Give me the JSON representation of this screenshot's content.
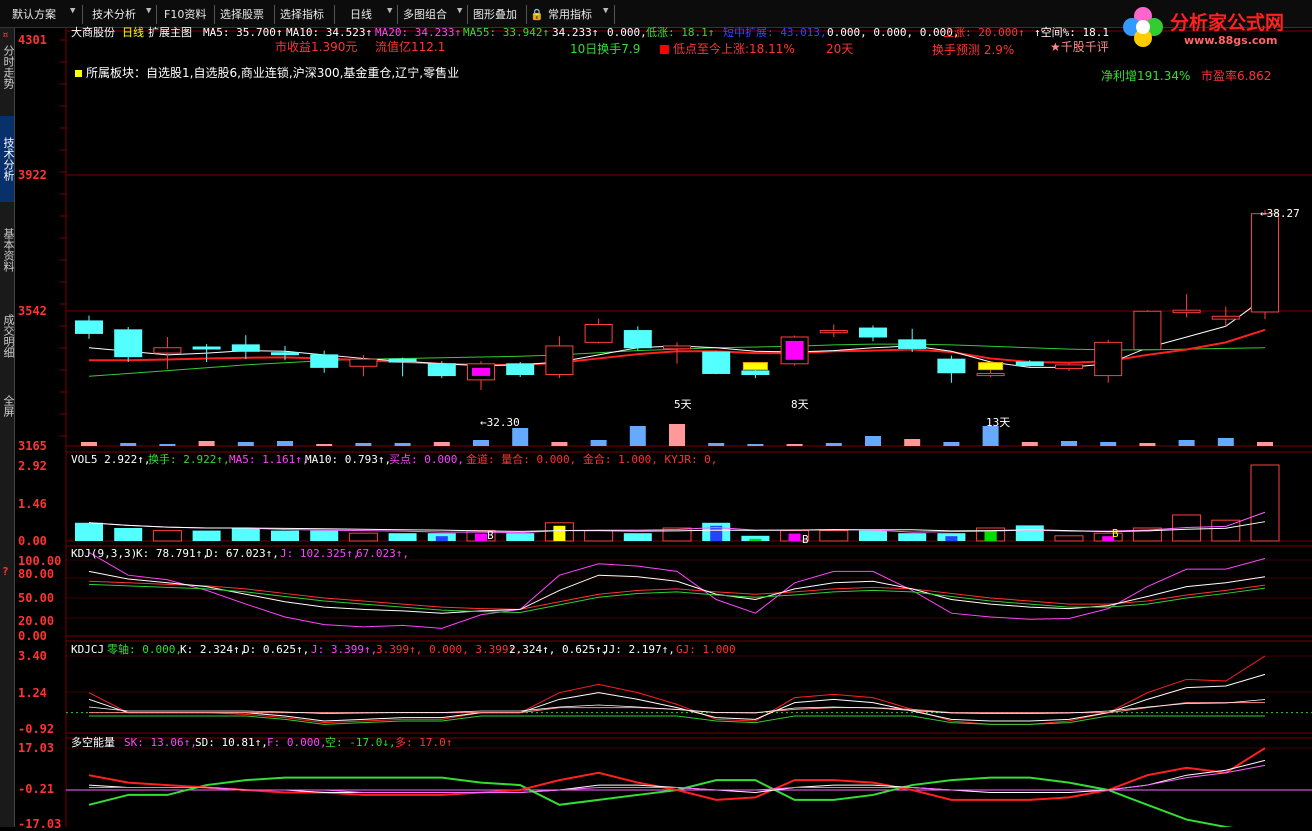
{
  "toolbar": {
    "items": [
      {
        "label": "默认方案",
        "arrow": true
      },
      {
        "label": "技术分析",
        "arrow": true
      },
      {
        "label": "F10资料",
        "arrow": false
      },
      {
        "label": "选择股票",
        "arrow": false
      },
      {
        "label": "选择指标",
        "arrow": false
      },
      {
        "label": "日线",
        "arrow": true
      },
      {
        "label": "多图组合",
        "arrow": true
      },
      {
        "label": "图形叠加",
        "arrow": false
      },
      {
        "label": "常用指标",
        "arrow": true
      }
    ]
  },
  "left_tabs": [
    "分时走势",
    "技术分析",
    "基本资料",
    "成交明细",
    "全屏"
  ],
  "logo": {
    "title": "分析家公式网",
    "url": "www.88gs.com"
  },
  "main_chart": {
    "stock_name": "大商股份",
    "period": "日线",
    "main_label": "扩展主图",
    "ma5": "MA5: 35.700↑",
    "ma10": "MA10: 34.523↑",
    "ma20": "MA20: 34.233↑",
    "ma55": "MA55: 33.942↑",
    "v1": "34.233↑",
    "v2": "0.000,",
    "low_rise": "低涨: 18.1↑",
    "hidden": "短中扩展: 43.013,",
    "v3": "0.000, 0.000, 0.000,",
    "rise": "上涨: 20.000↑",
    "space": "↑空间%: 18.1",
    "eps": "市收益1.390元",
    "float_cap": "流值亿112.1",
    "turnover10": "10日换手7.9",
    "low_to_now": "低点至今上涨:18.11%",
    "days": "20天",
    "turnover_forecast": "换手预测 2.9%",
    "rating": "★千股千评",
    "net_profit": "净利增191.34%",
    "pe": "市盈率6.862",
    "sector": "所属板块：自选股1,自选股6,商业连锁,沪深300,基金重仓,辽宁,零售业",
    "y_labels": [
      "4301",
      "3922",
      "3542",
      "3165"
    ],
    "annot_low": "←32.30",
    "annot_high": "←38.27",
    "annot_5d": "5天",
    "annot_8d": "8天",
    "annot_13d": "13天"
  },
  "vol_panel": {
    "header": [
      "VOL5 2.922↑,",
      "换手: 2.922↑,",
      "MA5: 1.161↑,",
      "MA10: 0.793↑,",
      "买点: 0.000,",
      "金道: 量合: 0.000, 金合: 1.000, KYJR: 0,"
    ],
    "y_labels": [
      "2.92",
      "1.46",
      "0.00"
    ],
    "b1": "B",
    "b2": "B",
    "b3": "B"
  },
  "kdj_panel": {
    "header": [
      "KDJ(9,3,3)",
      "K: 78.791↑,",
      "D: 67.023↑,",
      "J: 102.325↑,",
      "67.023↑,"
    ],
    "y_labels": [
      "100.00",
      "80.00",
      "50.00",
      "20.00",
      "0.00"
    ]
  },
  "kdjcj_panel": {
    "header": [
      "KDJCJ",
      "零轴: 0.000,",
      "K: 2.324↑,",
      "D: 0.625↑,",
      "J: 3.399↑,",
      "3.399↑, 0.000, 3.399↑,",
      "2.324↑, 0.625↑,",
      "JJ: 2.197↑,",
      "GJ: 1.000"
    ],
    "y_labels": [
      "3.40",
      "1.24",
      "-0.92"
    ]
  },
  "duokong_panel": {
    "header": [
      "多空能量",
      "SK: 13.06↑,",
      "SD: 10.81↑,",
      "F: 0.000,",
      "空: -17.0↓,",
      "多: 17.0↑"
    ],
    "y_labels": [
      "17.03",
      "-0.21",
      "-17.03"
    ]
  },
  "colors": {
    "grid": "#7a0000",
    "up": "#ff4040",
    "down": "#54ffff",
    "ma_white": "#ffffff",
    "ma_green": "#33cc33",
    "ma_red": "#ff2020",
    "magenta": "#ff00ff"
  },
  "candles": [
    {
      "o": 3515,
      "c": 3480,
      "h": 3530,
      "l": 3465,
      "dir": "down"
    },
    {
      "o": 3490,
      "c": 3415,
      "h": 3498,
      "l": 3400,
      "dir": "down"
    },
    {
      "o": 3425,
      "c": 3440,
      "h": 3470,
      "l": 3380,
      "dir": "up"
    },
    {
      "o": 3442,
      "c": 3442,
      "h": 3450,
      "l": 3400,
      "dir": "flat"
    },
    {
      "o": 3448,
      "c": 3430,
      "h": 3475,
      "l": 3408,
      "dir": "down"
    },
    {
      "o": 3426,
      "c": 3422,
      "h": 3445,
      "l": 3405,
      "dir": "flat"
    },
    {
      "o": 3420,
      "c": 3385,
      "h": 3432,
      "l": 3370,
      "dir": "down"
    },
    {
      "o": 3388,
      "c": 3408,
      "h": 3420,
      "l": 3360,
      "dir": "up"
    },
    {
      "o": 3408,
      "c": 3400,
      "h": 3412,
      "l": 3360,
      "dir": "down"
    },
    {
      "o": 3395,
      "c": 3362,
      "h": 3402,
      "l": 3355,
      "dir": "down"
    },
    {
      "o": 3350,
      "c": 3395,
      "h": 3402,
      "l": 3322,
      "dir": "up"
    },
    {
      "o": 3395,
      "c": 3365,
      "h": 3400,
      "l": 3358,
      "dir": "down"
    },
    {
      "o": 3365,
      "c": 3445,
      "h": 3472,
      "l": 3355,
      "dir": "up"
    },
    {
      "o": 3455,
      "c": 3505,
      "h": 3522,
      "l": 3452,
      "dir": "up"
    },
    {
      "o": 3488,
      "c": 3440,
      "h": 3500,
      "l": 3432,
      "dir": "down"
    },
    {
      "o": 3437,
      "c": 3445,
      "h": 3455,
      "l": 3395,
      "dir": "up"
    },
    {
      "o": 3428,
      "c": 3368,
      "h": 3430,
      "l": 3366,
      "dir": "flat_up"
    },
    {
      "o": 3375,
      "c": 3365,
      "h": 3378,
      "l": 3355,
      "dir": "down"
    },
    {
      "o": 3395,
      "c": 3470,
      "h": 3474,
      "l": 3390,
      "dir": "up"
    },
    {
      "o": 3482,
      "c": 3488,
      "h": 3505,
      "l": 3470,
      "dir": "up"
    },
    {
      "o": 3495,
      "c": 3470,
      "h": 3502,
      "l": 3458,
      "dir": "down"
    },
    {
      "o": 3462,
      "c": 3438,
      "h": 3493,
      "l": 3428,
      "dir": "down"
    },
    {
      "o": 3408,
      "c": 3370,
      "h": 3418,
      "l": 3342,
      "dir": "down"
    },
    {
      "o": 3362,
      "c": 3368,
      "h": 3392,
      "l": 3358,
      "dir": "up"
    },
    {
      "o": 3400,
      "c": 3390,
      "h": 3405,
      "l": 3388,
      "dir": "down"
    },
    {
      "o": 3382,
      "c": 3392,
      "h": 3395,
      "l": 3375,
      "dir": "up"
    },
    {
      "o": 3362,
      "c": 3455,
      "h": 3462,
      "l": 3342,
      "dir": "up"
    },
    {
      "o": 3435,
      "c": 3542,
      "h": 3545,
      "l": 3432,
      "dir": "up"
    },
    {
      "o": 3538,
      "c": 3545,
      "h": 3590,
      "l": 3525,
      "dir": "up"
    },
    {
      "o": 3520,
      "c": 3528,
      "h": 3555,
      "l": 3500,
      "dir": "up"
    },
    {
      "o": 3540,
      "c": 3815,
      "h": 3825,
      "l": 3520,
      "dir": "up"
    }
  ]
}
